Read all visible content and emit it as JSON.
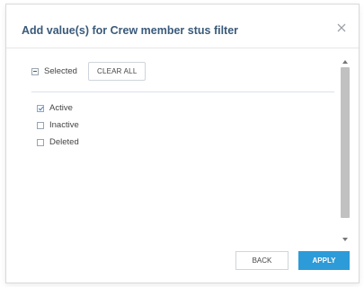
{
  "dialog": {
    "title": "Add value(s) for Crew member stus filter",
    "close_icon": "close-icon"
  },
  "toolbar": {
    "selected_label": "Selected",
    "selected_state": "indeterminate",
    "clear_all_label": "CLEAR ALL"
  },
  "options": [
    {
      "label": "Active",
      "checked": true
    },
    {
      "label": "Inactive",
      "checked": false
    },
    {
      "label": "Deleted",
      "checked": false
    }
  ],
  "footer": {
    "back_label": "BACK",
    "apply_label": "APPLY"
  },
  "colors": {
    "title": "#3a5a7a",
    "apply_bg": "#2d9bd8"
  }
}
